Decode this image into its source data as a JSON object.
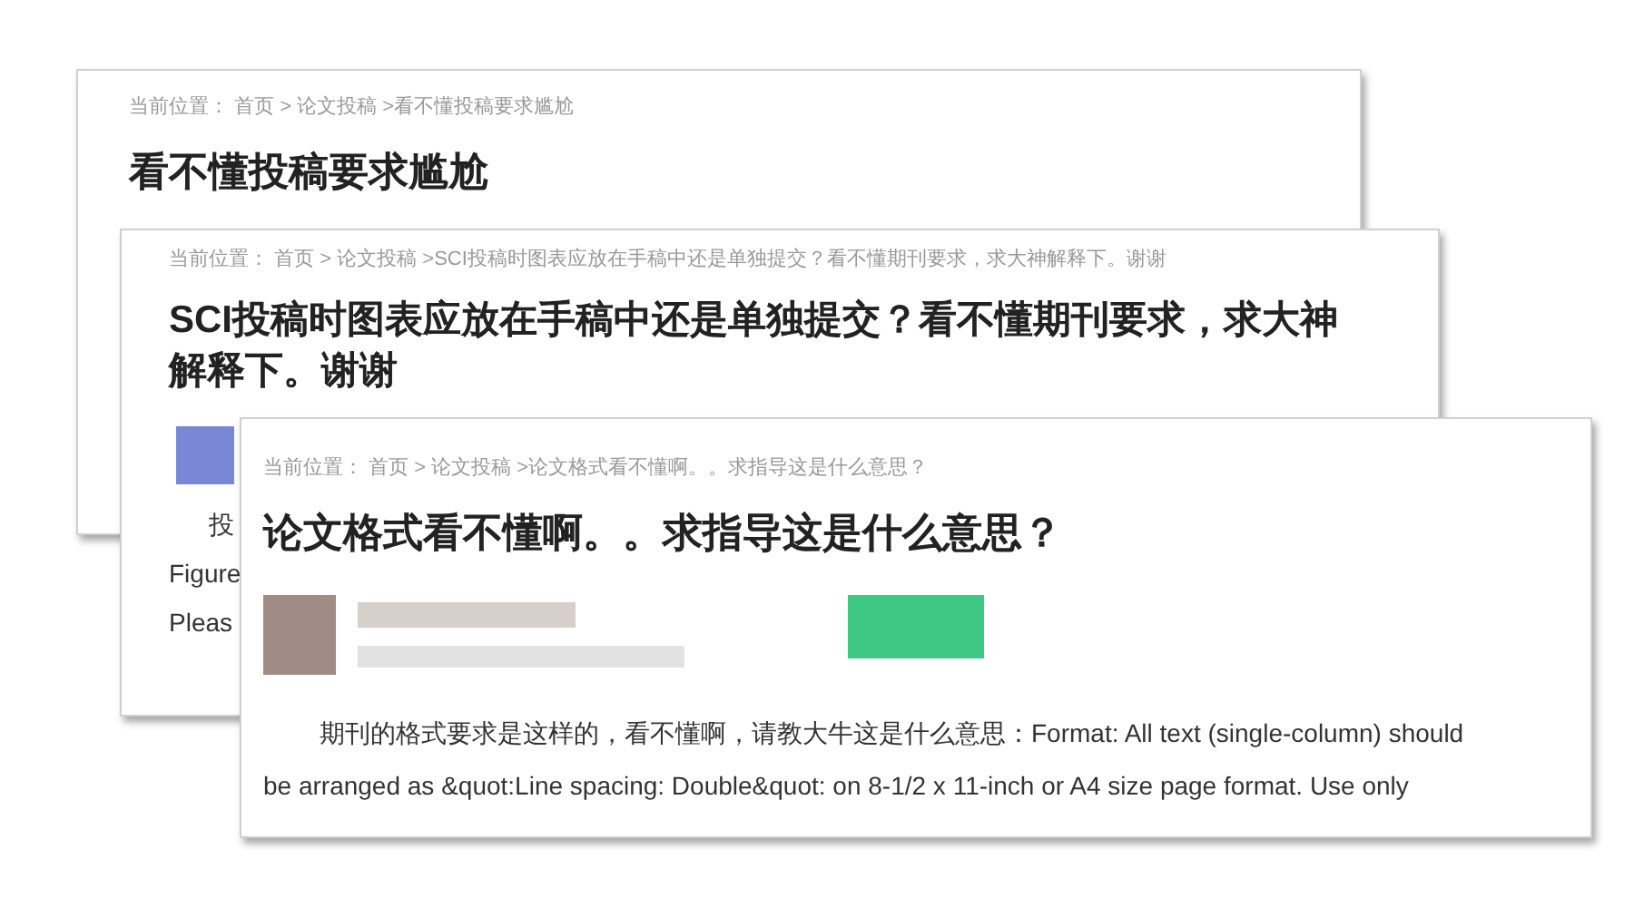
{
  "pages": [
    {
      "breadcrumb": "当前位置： 首页 > 论文投稿 >看不懂投稿要求尴尬",
      "title": "看不懂投稿要求尴尬"
    },
    {
      "breadcrumb": "当前位置： 首页 > 论文投稿 >SCI投稿时图表应放在手稿中还是单独提交？看不懂期刊要求，求大神解释下。谢谢",
      "title": "SCI投稿时图表应放在手稿中还是单独提交？看不懂期刊要求，求大神解释下。谢谢",
      "body_lines": [
        "投",
        "Figure",
        "Pleas"
      ]
    },
    {
      "breadcrumb": "当前位置： 首页 > 论文投稿 >论文格式看不懂啊。。求指导这是什么意思？",
      "title": "论文格式看不懂啊。。求指导这是什么意思？",
      "body_lines": [
        "期刊的格式要求是这样的，看不懂啊，请教大牛这是什么意思：Format: All text (single-column) should",
        "be arranged as &quot:Line spacing: Double&quot: on 8-1/2 x 11-inch or A4 size page format. Use only"
      ]
    }
  ]
}
